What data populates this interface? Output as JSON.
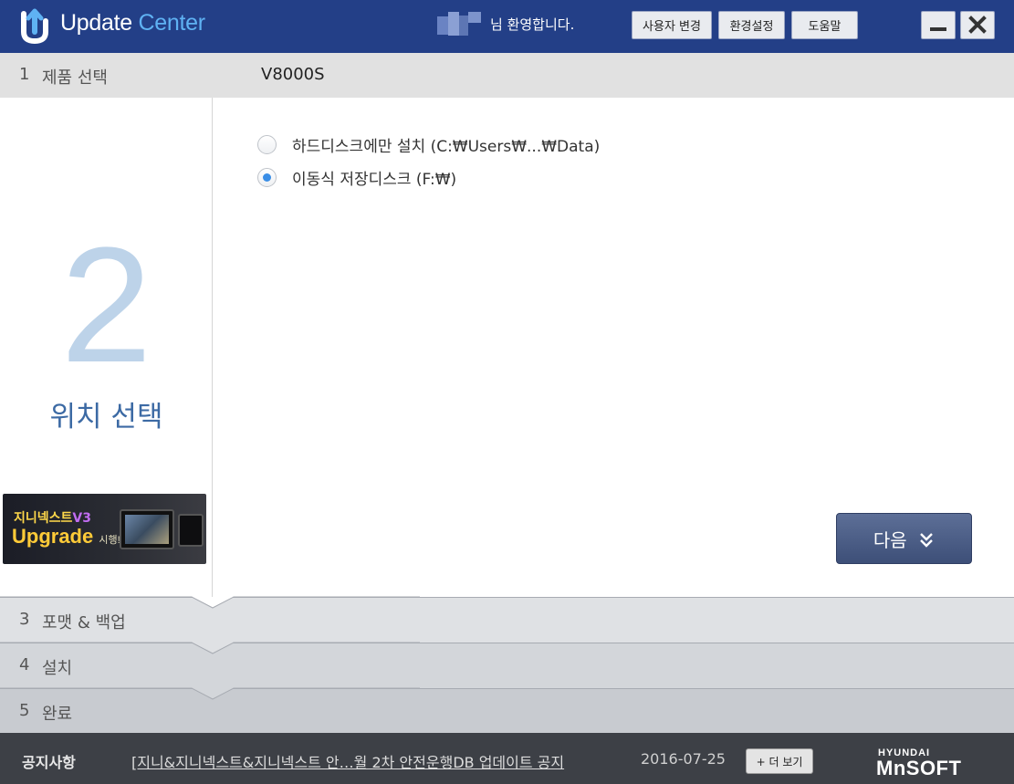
{
  "titlebar": {
    "title_part1": "Update",
    "title_part2": "Center",
    "welcome": "님 환영합니다.",
    "buttons": [
      "사용자 변경",
      "환경설정",
      "도움말"
    ],
    "minimize_icon": "minimize-icon",
    "close_icon": "close-icon",
    "colors": {
      "bar": "#233f87",
      "title_accent": "#5fb2f3"
    }
  },
  "steps": [
    {
      "num": "1",
      "label": "제품 선택",
      "value": "V8000S"
    },
    {
      "num": "2",
      "label": "위치 선택"
    },
    {
      "num": "3",
      "label": "포맷 & 백업"
    },
    {
      "num": "4",
      "label": "설치"
    },
    {
      "num": "5",
      "label": "완료"
    }
  ],
  "promo": {
    "line1_a": "지니넥스트",
    "line1_b": "V3",
    "line2_a": "Upgrade",
    "line2_b": "시행!"
  },
  "options": [
    {
      "label": "하드디스크에만 설치 (C:₩Users₩...₩Data)",
      "checked": false
    },
    {
      "label": "이동식 저장디스크 (F:₩)",
      "checked": true
    }
  ],
  "next_button": {
    "label": "다음",
    "icon": "double-chevron-down-icon"
  },
  "footer": {
    "notice_label": "공지사항",
    "notice_text": "[지니&지니넥스트&지니넥스트 안…월 2차 안전운행DB 업데이트 공지",
    "notice_date": "2016-07-25",
    "more_label": "+ 더 보기",
    "brand_top": "HYUNDAI",
    "brand_main": "MnSOFT"
  }
}
